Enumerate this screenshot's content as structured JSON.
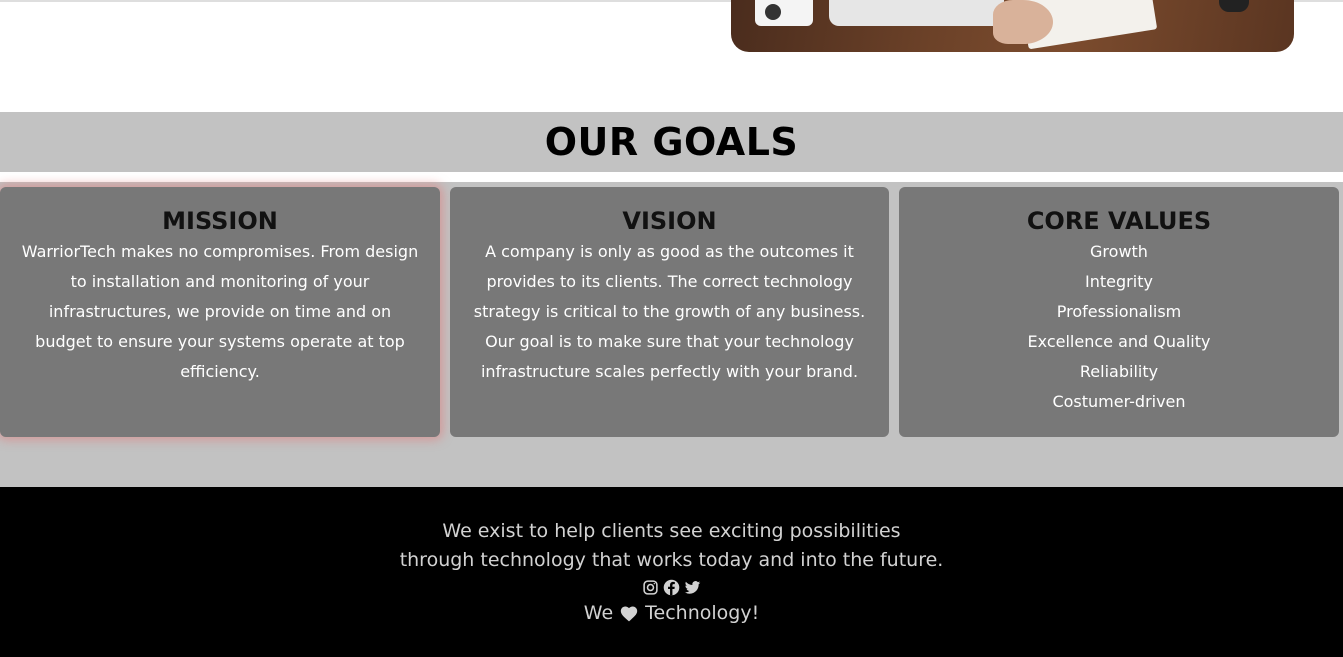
{
  "goals": {
    "title": "OUR GOALS",
    "mission": {
      "title": "MISSION",
      "text": "WarriorTech makes no compromises. From design to installation and monitoring of your infrastructures, we provide on time and on budget to ensure your systems operate at top efficiency."
    },
    "vision": {
      "title": "VISION",
      "text": "A company is only as good as the outcomes it provides to its clients. The correct technology strategy is critical to the growth of any business. Our goal is to make sure that your technology infrastructure scales perfectly with your brand."
    },
    "core_values": {
      "title": "CORE VALUES",
      "items": [
        "Growth",
        "Integrity",
        "Professionalism",
        "Excellence and Quality",
        "Reliability",
        "Costumer-driven"
      ]
    }
  },
  "footer": {
    "tagline_line1": "We exist to help clients see exciting possibilities",
    "tagline_line2": "through technology that works today and into the future.",
    "social_icons": [
      "instagram-icon",
      "facebook-icon",
      "twitter-icon"
    ],
    "love_prefix": "We",
    "love_suffix": "Technology!"
  },
  "colors": {
    "section_bg": "#c2c2c2",
    "card_bg": "#787878",
    "footer_bg": "#000000",
    "highlight_glow": "#e17878"
  }
}
